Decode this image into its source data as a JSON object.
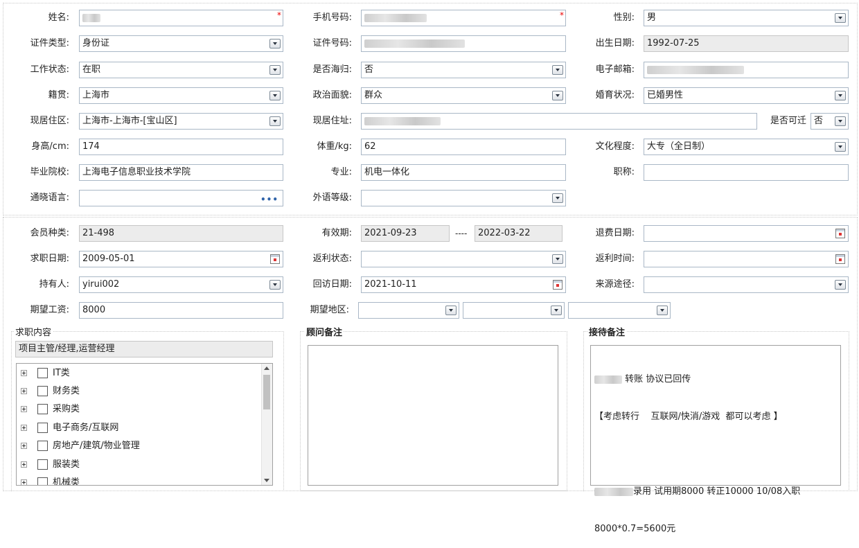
{
  "basic": {
    "name_label": "姓名:",
    "phone_label": "手机号码:",
    "gender_label": "性别:",
    "gender_value": "男",
    "id_type_label": "证件类型:",
    "id_type_value": "身份证",
    "id_no_label": "证件号码:",
    "birth_label": "出生日期:",
    "birth_value": "1992-07-25",
    "work_status_label": "工作状态:",
    "work_status_value": "在职",
    "returnee_label": "是否海归:",
    "returnee_value": "否",
    "email_label": "电子邮箱:",
    "native_label": "籍贯:",
    "native_value": "上海市",
    "political_label": "政治面貌:",
    "political_value": "群众",
    "marital_label": "婚育状况:",
    "marital_value": "已婚男性",
    "residence_area_label": "现居住区:",
    "residence_area_value": "上海市-上海市-[宝山区]",
    "address_label": "现居住址:",
    "relocate_label": "是否可迁",
    "relocate_value": "否",
    "height_label": "身高/cm:",
    "height_value": "174",
    "weight_label": "体重/kg:",
    "weight_value": "62",
    "education_label": "文化程度:",
    "education_value": "大专（全日制）",
    "school_label": "毕业院校:",
    "school_value": "上海电子信息职业技术学院",
    "major_label": "专业:",
    "major_value": "机电一体化",
    "title_label": "职称:",
    "language_label": "通晓语言:",
    "foreign_level_label": "外语等级:",
    "required_mark": "*"
  },
  "member": {
    "type_label": "会员种类:",
    "type_value": "21-498",
    "valid_label": "有效期:",
    "valid_from": "2021-09-23",
    "valid_sep": "----",
    "valid_to": "2022-03-22",
    "refund_date_label": "退费日期:",
    "job_date_label": "求职日期:",
    "job_date_value": "2009-05-01",
    "rebate_status_label": "返利状态:",
    "rebate_time_label": "返利时间:",
    "holder_label": "持有人:",
    "holder_value": "yirui002",
    "visit_date_label": "回访日期:",
    "visit_date_value": "2021-10-11",
    "source_label": "来源途径:",
    "salary_label": "期望工资:",
    "salary_value": "8000",
    "region_label": "期望地区:"
  },
  "job": {
    "legend": "求职内容",
    "selected": "项目主管/经理,运营经理",
    "categories": [
      "IT类",
      "财务类",
      "采购类",
      "电子商务/互联网",
      "房地产/建筑/物业管理",
      "服装类",
      "机械类"
    ]
  },
  "advisor": {
    "legend": "顾问备注",
    "text": ""
  },
  "reception": {
    "legend": "接待备注",
    "line1": "转账 协议已回传",
    "line2": "【考虑转行    互联网/快消/游戏  都可以考虑 】",
    "line3": "",
    "line4": "录用 试用期8000 转正10000 10/08入职",
    "line5": "8000*0.7=5600元"
  }
}
